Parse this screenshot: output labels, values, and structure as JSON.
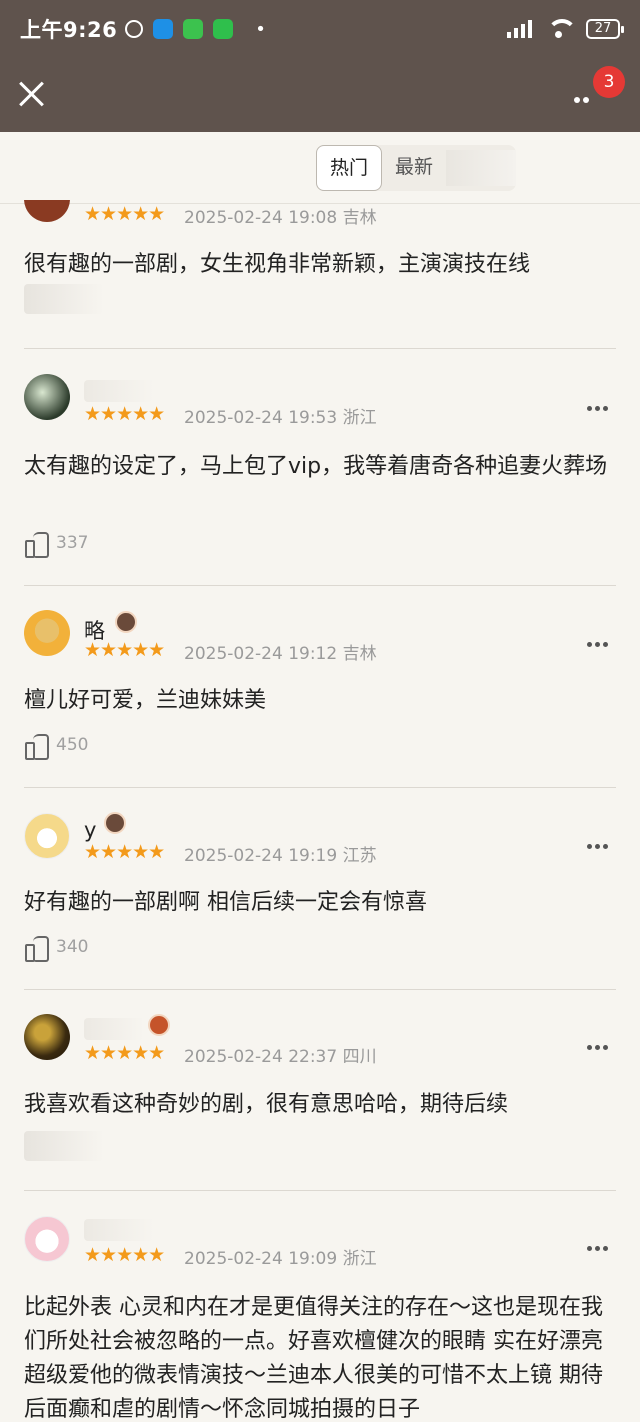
{
  "status_bar": {
    "time": "上午9:26",
    "battery": "27"
  },
  "header": {
    "badge_count": "3",
    "close_icon": "close-icon",
    "more_icon": "more-icon"
  },
  "tabs": [
    {
      "label": "热门",
      "active": true
    },
    {
      "label": "最新",
      "active": false
    }
  ],
  "comments": [
    {
      "name": "",
      "stars": "★★★★★",
      "date": "2025-02-24 19:08",
      "location": "吉林",
      "text": "很有趣的一部剧，女生视角非常新颖，主演演技在线",
      "likes": ""
    },
    {
      "name": "",
      "stars": "★★★★★",
      "date": "2025-02-24 19:53",
      "location": "浙江",
      "text": "太有趣的设定了，马上包了vip，我等着唐奇各种追妻火葬场",
      "likes": "337"
    },
    {
      "name": "略",
      "stars": "★★★★★",
      "date": "2025-02-24 19:12",
      "location": "吉林",
      "text": "檀儿好可爱，兰迪妹妹美",
      "likes": "450"
    },
    {
      "name": "y",
      "stars": "★★★★★",
      "date": "2025-02-24 19:19",
      "location": "江苏",
      "text": "好有趣的一部剧啊 相信后续一定会有惊喜",
      "likes": "340"
    },
    {
      "name": "",
      "stars": "★★★★★",
      "date": "2025-02-24 22:37",
      "location": "四川",
      "text": "我喜欢看这种奇妙的剧，很有意思哈哈，期待后续",
      "likes": ""
    },
    {
      "name": "",
      "stars": "★★★★★",
      "date": "2025-02-24 19:09",
      "location": "浙江",
      "text": "比起外表 心灵和内在才是更值得关注的存在～这也是现在我们所处社会被忽略的一点。好喜欢檀健次的眼睛 实在好漂亮 超级爱他的微表情演技～兰迪本人很美的可惜不太上镜 期待后面癫和虐的剧情～怀念同城拍摄的日子",
      "likes": ""
    }
  ],
  "colors": {
    "header_bg": "#5f534d",
    "star": "#f39a1b",
    "badge": "#e53935"
  }
}
